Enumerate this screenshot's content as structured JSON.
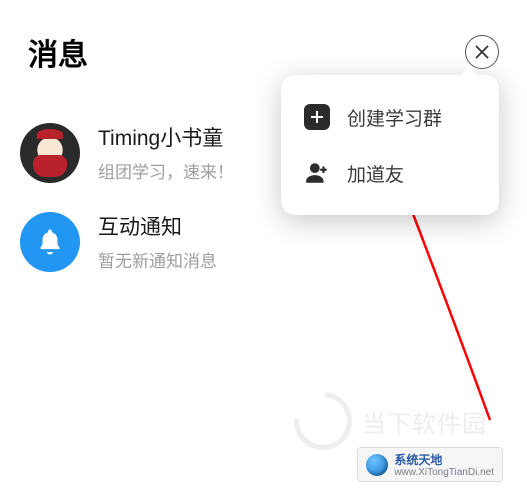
{
  "header": {
    "title": "消息"
  },
  "messages": [
    {
      "title": "Timing小书童",
      "subtitle": "组团学习，速来！"
    },
    {
      "title": "互动通知",
      "subtitle": "暂无新通知消息"
    }
  ],
  "popover": {
    "items": [
      {
        "label": "创建学习群",
        "icon": "plus-square"
      },
      {
        "label": "加道友",
        "icon": "person-plus"
      }
    ]
  },
  "watermark": {
    "brand_text": "当下软件园",
    "band_cn": "系统天地",
    "band_en": "www.XiTongTianDi.net"
  },
  "annotation": {
    "arrow_color": "#ff0000"
  }
}
